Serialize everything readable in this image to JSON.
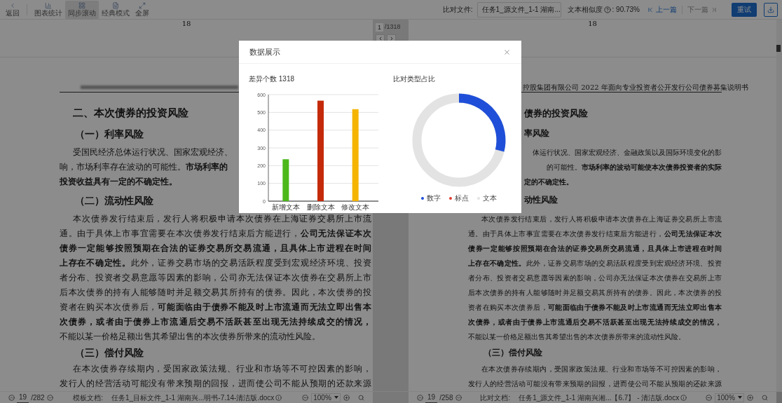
{
  "toolbar": {
    "items": [
      {
        "label": "返回",
        "selected": false
      },
      {
        "label": "图表统计",
        "selected": false
      },
      {
        "label": "同步滚动",
        "selected": true
      },
      {
        "label": "经典模式",
        "selected": false
      },
      {
        "label": "全屏",
        "selected": false
      }
    ],
    "compare_label": "比对文件:",
    "compare_file": "任务1_源文件_1-1 湖南...",
    "similarity_label": "文本相似度",
    "similarity_value": ": 90.73%",
    "prev": {
      "label": "上一篇",
      "disabled": false
    },
    "next": {
      "label": "下一篇",
      "disabled": true
    },
    "retry": "重试"
  },
  "documents": [
    {
      "page_number": "18",
      "header_blurred": true,
      "lines": [
        {
          "kind": "heading",
          "bold": true,
          "text": "二、本次债券的投资风险"
        },
        {
          "kind": "subheading",
          "bold": true,
          "text": "（一）利率风险"
        },
        {
          "kind": "cut_para",
          "bold": false,
          "text": "受国民经济总体运行状况、国家宏观经济、"
        },
        {
          "kind": "cut",
          "bold": false,
          "text": "响，市场利率存在波动的可能性。**市场利率的**"
        },
        {
          "kind": "cut",
          "bold": true,
          "text": "投资收益具有一定的不确定性。"
        },
        {
          "kind": "subheading",
          "bold": true,
          "text": "（二）流动性风险"
        },
        {
          "kind": "para",
          "bold": false,
          "text": "本次债券发行结束后，发行人将积极申请本次债券在上海证券交易所上市流"
        },
        {
          "kind": "line",
          "bold": false,
          "text": "通。由于具体上市事宜需要在本次债券发行结束后方能进行，**公司无法保证本次**"
        },
        {
          "kind": "line",
          "bold": true,
          "text": "债券一定能够按照预期在合法的证券交易所交易流通，且具体上市进程在时间"
        },
        {
          "kind": "line",
          "bold": false,
          "text": "**上存在不确定性。**此外，证券交易市场的交易活跃程度受到宏观经济环境、投资"
        },
        {
          "kind": "line",
          "bold": false,
          "text": "者分布、投资者交易意愿等因素的影响，公司亦无法保证本次债券在交易所上市"
        },
        {
          "kind": "line",
          "bold": false,
          "text": "后本次债券的持有人能够随时并足额交易其所持有的债券。因此，本次债券的投"
        },
        {
          "kind": "line",
          "bold": false,
          "text": "资者在购买本次债券后，**可能面临由于债券不能及时上市流通而无法立即出售本**"
        },
        {
          "kind": "line",
          "bold": true,
          "text": "次债券，或者由于债券上市流通后交易不活跃甚至出现无法持续成交的情况，"
        },
        {
          "kind": "cut",
          "bold": false,
          "text": "不能以某一价格足额出售其希望出售的本次债券所带来的流动性风险。"
        },
        {
          "kind": "subheading",
          "bold": true,
          "text": "（三）偿付风险"
        },
        {
          "kind": "para",
          "bold": false,
          "text": "在本次债券存续期内，受国家政策法规、行业和市场等不可控因素的影响，"
        },
        {
          "kind": "line",
          "bold": false,
          "text": "发行人的经营活动可能没有带来预期的回报，进而使公司不能从预期的还款来源"
        }
      ]
    },
    {
      "page_number": "18",
      "header_blurred": false,
      "header": "控股集团有限公司 2022 年面向专业投资者公开发行公司债券募集说明书",
      "lines": [
        {
          "kind": "tail_heading",
          "bold": true,
          "text": "债券的投资风险"
        },
        {
          "kind": "tail_subheading",
          "bold": true,
          "text": "率风险"
        },
        {
          "kind": "tail",
          "bold": false,
          "text": "体运行状况、国家宏观经济、金融政策以及国际环境变化的影"
        },
        {
          "kind": "tail",
          "bold": false,
          "text": "的可能性。**市场利率的波动可能使本次债券投资者的实际**"
        },
        {
          "kind": "tail_start",
          "bold": true,
          "text": "定的不确定性。"
        },
        {
          "kind": "tail_subheading",
          "bold": true,
          "text": "动性风险"
        },
        {
          "kind": "para",
          "bold": false,
          "text": "本次债券发行结束后，发行人将积极申请本次债券在上海证券交易所上市流"
        },
        {
          "kind": "line",
          "bold": false,
          "text": "通。由于具体上市事宜需要在本次债券发行结束后方能进行，**公司无法保证本次**"
        },
        {
          "kind": "line",
          "bold": true,
          "text": "债券一定能够按照预期在合法的证券交易所交易流通，且具体上市进程在时间"
        },
        {
          "kind": "line",
          "bold": false,
          "text": "**上存在不确定性。**此外，证券交易市场的交易活跃程度受到宏观经济环境、投资"
        },
        {
          "kind": "line",
          "bold": false,
          "text": "者分布、投资者交易意愿等因素的影响，公司亦无法保证本次债券在交易所上市"
        },
        {
          "kind": "line",
          "bold": false,
          "text": "后本次债券的持有人能够随时并足额交易其所持有的债券。因此，本次债券的投"
        },
        {
          "kind": "line",
          "bold": false,
          "text": "资者在购买本次债券后，**可能面临由于债券不能及时上市流通而无法立即出售本**"
        },
        {
          "kind": "line",
          "bold": true,
          "text": "次债券，或者由于债券上市流通后交易不活跃甚至出现无法持续成交的情况，"
        },
        {
          "kind": "cut",
          "bold": false,
          "text": "不能以某一价格足额出售其希望出售的本次债券所带来的流动性风险。"
        },
        {
          "kind": "subheading",
          "bold": true,
          "text": "（三）偿付风险"
        },
        {
          "kind": "para",
          "bold": false,
          "text": "在本次债券存续期内，受国家政策法规、行业和市场等不可控因素的影响，"
        },
        {
          "kind": "line",
          "bold": false,
          "text": "发行人的经营活动可能没有带来预期的回报，进而使公司不能从预期的还款来源"
        }
      ]
    }
  ],
  "pager": {
    "current": "1",
    "total": "/1318"
  },
  "status": [
    {
      "page": "19",
      "total": "/282",
      "doc_label": "模板文档:",
      "doc_name": "任务1_目标文件_1-1 湖南兴...明书-7.14-清洁版.docx",
      "zoom": "100%"
    },
    {
      "page": "19",
      "total": "/258",
      "doc_label": "比对文档:",
      "doc_name": "任务1_源文件_1-1 湖南兴湘...【6.7】 - 清洁版.docx",
      "zoom": "100%"
    }
  ],
  "dialog": {
    "title": "数据展示",
    "bar_chart": {
      "chart_data": {
        "type": "bar",
        "title": "差异个数 1318",
        "categories": [
          "新增文本",
          "删除文本",
          "修改文本"
        ],
        "values": [
          236,
          566,
          518
        ],
        "colors": [
          "#4cb81b",
          "#c42a0a",
          "#f5b400"
        ],
        "grid": true,
        "ylim": [
          0,
          600
        ],
        "yticks": [
          0,
          100,
          200,
          300,
          400,
          500,
          600
        ]
      }
    },
    "donut": {
      "title": "比对类型占比",
      "legend": [
        {
          "label": "数字",
          "color": "#1f4fd8"
        },
        {
          "label": "标点",
          "color": "#e03c31"
        },
        {
          "label": "文本",
          "color": "#e3e3e3"
        }
      ]
    }
  }
}
